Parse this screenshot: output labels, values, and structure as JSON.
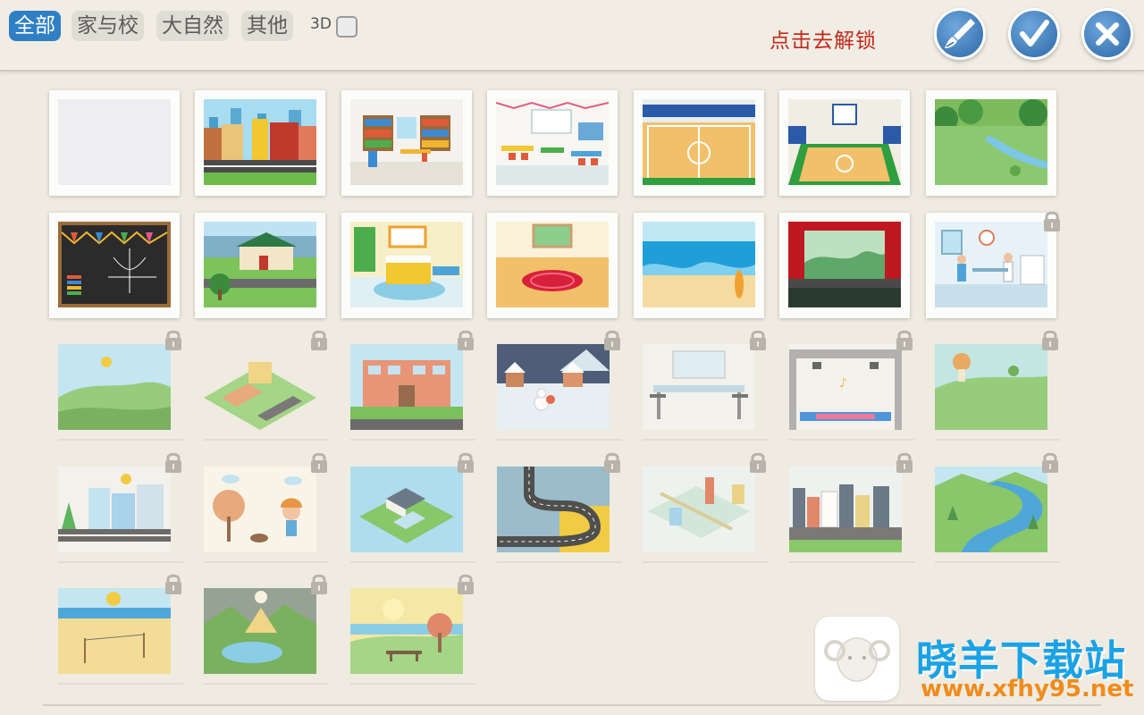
{
  "tabs": [
    {
      "label": "全部",
      "active": true
    },
    {
      "label": "家与校",
      "active": false
    },
    {
      "label": "大自然",
      "active": false
    },
    {
      "label": "其他",
      "active": false
    }
  ],
  "toggle_3d": {
    "label": "3D",
    "checked": false
  },
  "unlock_text": "点击去解锁",
  "buttons": {
    "brush": "brush-icon",
    "confirm": "checkmark-icon",
    "close": "close-icon"
  },
  "colors": {
    "tab_active": "#2f7fc4",
    "unlock_text": "#c12a1e",
    "button_blue": "#2b67a8",
    "background": "#efebe1"
  },
  "scenes": [
    {
      "id": 1,
      "locked": false
    },
    {
      "id": 2,
      "locked": false
    },
    {
      "id": 3,
      "locked": false
    },
    {
      "id": 4,
      "locked": false
    },
    {
      "id": 5,
      "locked": false
    },
    {
      "id": 6,
      "locked": false
    },
    {
      "id": 7,
      "locked": false
    },
    {
      "id": 8,
      "locked": false
    },
    {
      "id": 9,
      "locked": false
    },
    {
      "id": 10,
      "locked": false
    },
    {
      "id": 11,
      "locked": false
    },
    {
      "id": 12,
      "locked": false
    },
    {
      "id": 13,
      "locked": false
    },
    {
      "id": 14,
      "locked": true
    },
    {
      "id": 15,
      "locked": true
    },
    {
      "id": 16,
      "locked": true
    },
    {
      "id": 17,
      "locked": true
    },
    {
      "id": 18,
      "locked": true
    },
    {
      "id": 19,
      "locked": true
    },
    {
      "id": 20,
      "locked": true
    },
    {
      "id": 21,
      "locked": true
    },
    {
      "id": 22,
      "locked": true
    },
    {
      "id": 23,
      "locked": true
    },
    {
      "id": 24,
      "locked": true
    },
    {
      "id": 25,
      "locked": true
    },
    {
      "id": 26,
      "locked": true
    },
    {
      "id": 27,
      "locked": true
    },
    {
      "id": 28,
      "locked": true
    },
    {
      "id": 29,
      "locked": true
    },
    {
      "id": 30,
      "locked": true
    },
    {
      "id": 31,
      "locked": true
    }
  ],
  "watermark": {
    "name": "晓羊下载站",
    "url": "www.xfhy95.net",
    "logo": "sheep-logo-icon"
  }
}
